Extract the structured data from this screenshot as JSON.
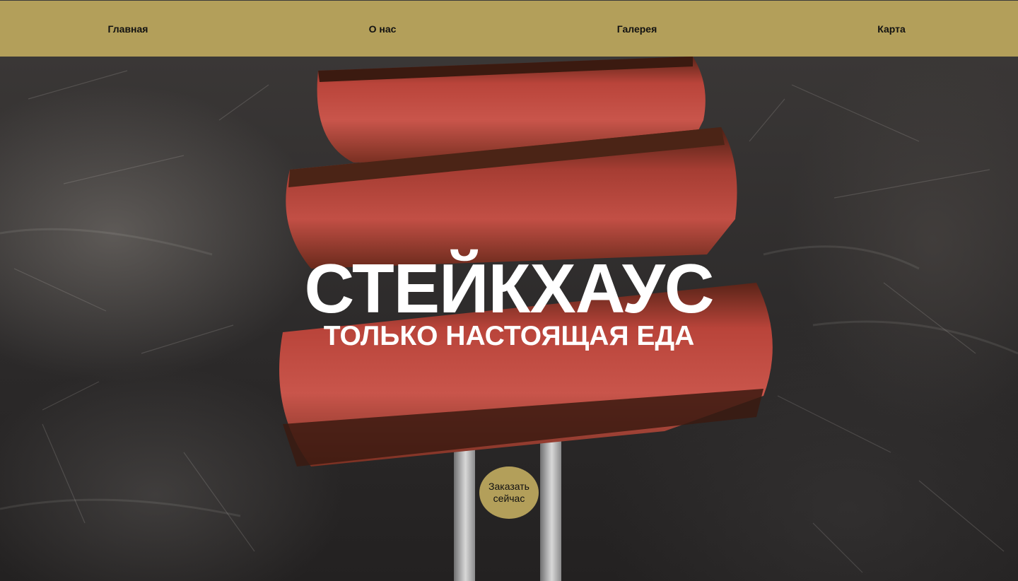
{
  "nav": {
    "items": [
      {
        "label": "Главная"
      },
      {
        "label": "О нас"
      },
      {
        "label": "Галерея"
      },
      {
        "label": "Карта"
      }
    ]
  },
  "hero": {
    "title": "СТЕЙКХАУС",
    "subtitle": "ТОЛЬКО НАСТОЯЩАЯ ЕДА",
    "order_button_label": "Заказать сейчас"
  },
  "colors": {
    "nav_background": "#b39f5a",
    "button_background": "#b39f5a",
    "headline_text": "#ffffff"
  }
}
